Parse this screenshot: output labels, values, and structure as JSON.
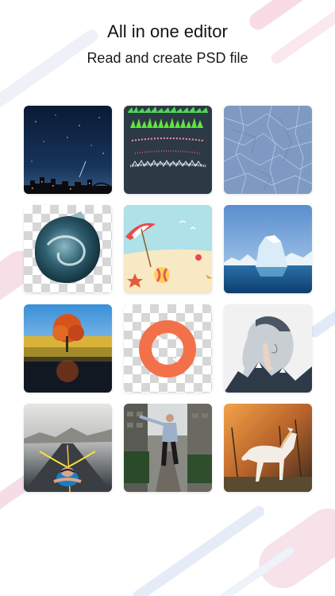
{
  "header": {
    "title": "All in one editor",
    "subtitle": "Read and create PSD file"
  },
  "tiles": [
    {
      "name": "night-sky-city-photo"
    },
    {
      "name": "grass-brushes-photo"
    },
    {
      "name": "ice-texture-photo"
    },
    {
      "name": "cutout-wave-sphere-image"
    },
    {
      "name": "beach-illustration-image"
    },
    {
      "name": "iceberg-photo"
    },
    {
      "name": "autumn-tree-reflection-photo"
    },
    {
      "name": "orange-ring-cutout-image"
    },
    {
      "name": "double-exposure-woman-photo"
    },
    {
      "name": "swimmer-road-composite-photo"
    },
    {
      "name": "man-city-street-photo"
    },
    {
      "name": "white-horse-photo"
    }
  ],
  "colors": {
    "background": "#ffffff",
    "accent_pink": "#f7d9e3",
    "accent_blue": "#dde6f5",
    "orange_ring": "#f3714a"
  }
}
